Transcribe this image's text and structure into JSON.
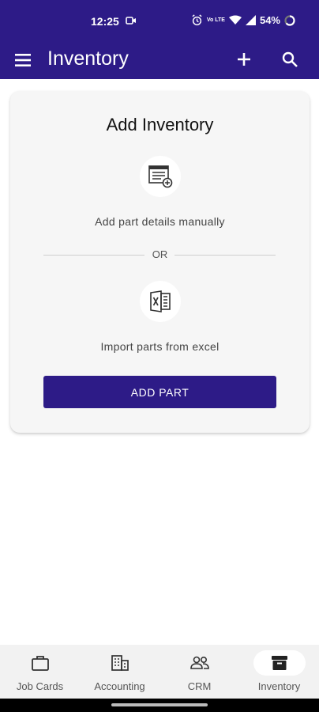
{
  "status": {
    "time": "12:25",
    "net_line1": "Vo LTE",
    "net_line2": "",
    "battery": "54%"
  },
  "appbar": {
    "title": "Inventory"
  },
  "card": {
    "title": "Add Inventory",
    "option1_label": "Add part details manually",
    "or_label": "OR",
    "option2_label": "Import parts from excel",
    "button_label": "ADD PART"
  },
  "bottom_nav": {
    "items": [
      {
        "label": "Job Cards",
        "icon": "briefcase-icon"
      },
      {
        "label": "Accounting",
        "icon": "building-icon"
      },
      {
        "label": "CRM",
        "icon": "people-icon"
      },
      {
        "label": "Inventory",
        "icon": "archive-box-icon"
      }
    ],
    "active_index": 3
  },
  "colors": {
    "primary": "#2d1b87",
    "card_bg": "#f6f6f6",
    "nav_bg": "#f2f2f2"
  }
}
